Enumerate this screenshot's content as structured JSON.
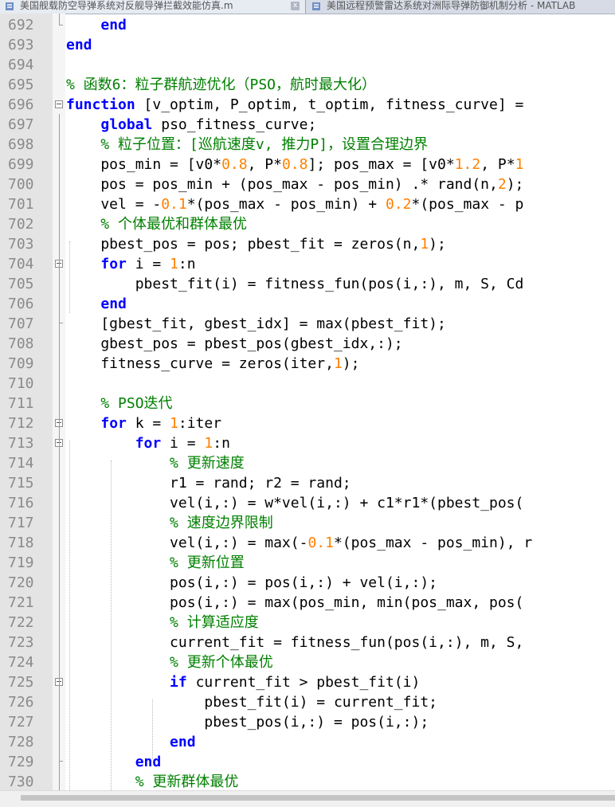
{
  "tabs": [
    {
      "label": "美国舰载防空导弹系统对反舰导弹拦截效能仿真.m",
      "active": true,
      "close": "x"
    },
    {
      "label": "美国远程预警雷达系统对洲际导弹防御机制分析 - MATLAB",
      "active": false
    }
  ],
  "colors": {
    "keyword": "#0000ff",
    "number": "#ff8000",
    "comment": "#008000",
    "text": "#000000",
    "gutter": "#e4e4e4"
  },
  "lines": [
    {
      "num": "692",
      "segs": [
        [
          "tx",
          "    "
        ],
        [
          "kw",
          "end"
        ]
      ]
    },
    {
      "num": "693",
      "segs": [
        [
          "kw",
          "end"
        ]
      ]
    },
    {
      "num": "694",
      "segs": []
    },
    {
      "num": "695",
      "segs": [
        [
          "cm",
          "% 函数6：粒子群航迹优化（PSO，航时最大化）"
        ]
      ]
    },
    {
      "num": "696",
      "segs": [
        [
          "kw",
          "function"
        ],
        [
          "tx",
          " [v_optim, P_optim, t_optim, fitness_curve] ="
        ]
      ]
    },
    {
      "num": "697",
      "segs": [
        [
          "tx",
          "    "
        ],
        [
          "kw",
          "global"
        ],
        [
          "tx",
          " pso_fitness_curve;"
        ]
      ]
    },
    {
      "num": "698",
      "segs": [
        [
          "tx",
          "    "
        ],
        [
          "cm",
          "% 粒子位置：[巡航速度v, 推力P]，设置合理边界"
        ]
      ]
    },
    {
      "num": "699",
      "segs": [
        [
          "tx",
          "    pos_min = [v0*"
        ],
        [
          "num",
          "0.8"
        ],
        [
          "tx",
          ", P*"
        ],
        [
          "num",
          "0.8"
        ],
        [
          "tx",
          "]; pos_max = [v0*"
        ],
        [
          "num",
          "1.2"
        ],
        [
          "tx",
          ", P*"
        ],
        [
          "num",
          "1"
        ]
      ]
    },
    {
      "num": "700",
      "segs": [
        [
          "tx",
          "    pos = pos_min + (pos_max - pos_min) .* rand(n,"
        ],
        [
          "num",
          "2"
        ],
        [
          "tx",
          ");"
        ]
      ]
    },
    {
      "num": "701",
      "segs": [
        [
          "tx",
          "    vel = -"
        ],
        [
          "num",
          "0.1"
        ],
        [
          "tx",
          "*(pos_max - pos_min) + "
        ],
        [
          "num",
          "0.2"
        ],
        [
          "tx",
          "*(pos_max - p"
        ]
      ]
    },
    {
      "num": "702",
      "segs": [
        [
          "tx",
          "    "
        ],
        [
          "cm",
          "% 个体最优和群体最优"
        ]
      ]
    },
    {
      "num": "703",
      "segs": [
        [
          "tx",
          "    pbest_pos = pos; pbest_fit = zeros(n,"
        ],
        [
          "num",
          "1"
        ],
        [
          "tx",
          ");"
        ]
      ]
    },
    {
      "num": "704",
      "segs": [
        [
          "tx",
          "    "
        ],
        [
          "kw",
          "for"
        ],
        [
          "tx",
          " i = "
        ],
        [
          "num",
          "1"
        ],
        [
          "tx",
          ":n"
        ]
      ]
    },
    {
      "num": "705",
      "segs": [
        [
          "tx",
          "        pbest_fit(i) = fitness_fun(pos(i,:), m, S, Cd"
        ]
      ]
    },
    {
      "num": "706",
      "segs": [
        [
          "tx",
          "    "
        ],
        [
          "kw",
          "end"
        ]
      ]
    },
    {
      "num": "707",
      "segs": [
        [
          "tx",
          "    [gbest_fit, gbest_idx] = max(pbest_fit);"
        ]
      ]
    },
    {
      "num": "708",
      "segs": [
        [
          "tx",
          "    gbest_pos = pbest_pos(gbest_idx,:);"
        ]
      ]
    },
    {
      "num": "709",
      "segs": [
        [
          "tx",
          "    fitness_curve = zeros(iter,"
        ],
        [
          "num",
          "1"
        ],
        [
          "tx",
          ");"
        ]
      ]
    },
    {
      "num": "710",
      "segs": []
    },
    {
      "num": "711",
      "segs": [
        [
          "tx",
          "    "
        ],
        [
          "cm",
          "% PSO迭代"
        ]
      ]
    },
    {
      "num": "712",
      "segs": [
        [
          "tx",
          "    "
        ],
        [
          "kw",
          "for"
        ],
        [
          "tx",
          " k = "
        ],
        [
          "num",
          "1"
        ],
        [
          "tx",
          ":iter"
        ]
      ]
    },
    {
      "num": "713",
      "segs": [
        [
          "tx",
          "        "
        ],
        [
          "kw",
          "for"
        ],
        [
          "tx",
          " i = "
        ],
        [
          "num",
          "1"
        ],
        [
          "tx",
          ":n"
        ]
      ]
    },
    {
      "num": "714",
      "segs": [
        [
          "tx",
          "            "
        ],
        [
          "cm",
          "% 更新速度"
        ]
      ]
    },
    {
      "num": "715",
      "segs": [
        [
          "tx",
          "            r1 = rand; r2 = rand;"
        ]
      ]
    },
    {
      "num": "716",
      "segs": [
        [
          "tx",
          "            vel(i,:) = w*vel(i,:) + c1*r1*(pbest_pos("
        ]
      ]
    },
    {
      "num": "717",
      "segs": [
        [
          "tx",
          "            "
        ],
        [
          "cm",
          "% 速度边界限制"
        ]
      ]
    },
    {
      "num": "718",
      "segs": [
        [
          "tx",
          "            vel(i,:) = max(-"
        ],
        [
          "num",
          "0.1"
        ],
        [
          "tx",
          "*(pos_max - pos_min), r"
        ]
      ]
    },
    {
      "num": "719",
      "segs": [
        [
          "tx",
          "            "
        ],
        [
          "cm",
          "% 更新位置"
        ]
      ]
    },
    {
      "num": "720",
      "segs": [
        [
          "tx",
          "            pos(i,:) = pos(i,:) + vel(i,:);"
        ]
      ]
    },
    {
      "num": "721",
      "segs": [
        [
          "tx",
          "            pos(i,:) = max(pos_min, min(pos_max, pos("
        ]
      ]
    },
    {
      "num": "722",
      "segs": [
        [
          "tx",
          "            "
        ],
        [
          "cm",
          "% 计算适应度"
        ]
      ]
    },
    {
      "num": "723",
      "segs": [
        [
          "tx",
          "            current_fit = fitness_fun(pos(i,:), m, S, "
        ]
      ]
    },
    {
      "num": "724",
      "segs": [
        [
          "tx",
          "            "
        ],
        [
          "cm",
          "% 更新个体最优"
        ]
      ]
    },
    {
      "num": "725",
      "segs": [
        [
          "tx",
          "            "
        ],
        [
          "kw",
          "if"
        ],
        [
          "tx",
          " current_fit > pbest_fit(i)"
        ]
      ]
    },
    {
      "num": "726",
      "segs": [
        [
          "tx",
          "                pbest_fit(i) = current_fit;"
        ]
      ]
    },
    {
      "num": "727",
      "segs": [
        [
          "tx",
          "                pbest_pos(i,:) = pos(i,:);"
        ]
      ]
    },
    {
      "num": "728",
      "segs": [
        [
          "tx",
          "            "
        ],
        [
          "kw",
          "end"
        ]
      ]
    },
    {
      "num": "729",
      "segs": [
        [
          "tx",
          "        "
        ],
        [
          "kw",
          "end"
        ]
      ]
    },
    {
      "num": "730",
      "segs": [
        [
          "tx",
          "        "
        ],
        [
          "cm",
          "% 更新群体最优"
        ]
      ]
    }
  ],
  "fold_markers": [
    "696",
    "704",
    "712",
    "713",
    "725"
  ]
}
